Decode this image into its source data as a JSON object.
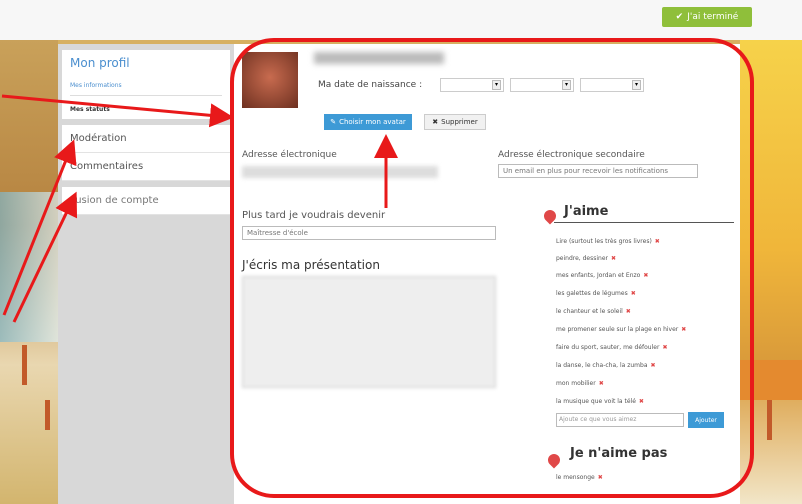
{
  "top_button": {
    "label": "J'ai terminé",
    "icon": "check-icon"
  },
  "sidebar": {
    "title": "Mon profil",
    "sub_link": "Mes informations",
    "sub_active": "Mes statuts",
    "items": [
      {
        "label": "Modération"
      },
      {
        "label": "Commentaires"
      },
      {
        "label": "Fusion de compte"
      }
    ]
  },
  "profile": {
    "dob_label": "Ma date de naissance :",
    "change_photo_label": "Choisir mon avatar",
    "delete_label": "Supprimer"
  },
  "form": {
    "email_label": "Adresse électronique",
    "secondary_email_label": "Adresse électronique secondaire",
    "secondary_email_placeholder": "Un email en plus pour recevoir les notifications",
    "career_label": "Plus tard je voudrais devenir",
    "career_value": "Maîtresse d'école",
    "presentation_title": "J'écris ma présentation"
  },
  "likes": {
    "title": "J'aime",
    "items": [
      "Lire (surtout les très gros livres)",
      "peindre, dessiner",
      "mes enfants, Jordan et Enzo",
      "les galettes de légumes",
      "le chanteur et le soleil",
      "me promener seule sur la plage en hiver",
      "faire du sport, sauter, me défouler",
      "la danse, le cha-cha, la zumba",
      "mon mobilier",
      "la musique que voit la télé"
    ],
    "add_placeholder": "Ajoute ce que vous aimez",
    "add_button": "Ajouter",
    "dislikes_title": "Je n'aime pas",
    "dislike_items": [
      "le mensonge"
    ]
  },
  "colors": {
    "accent": "#3d9ad6",
    "annotation": "#e8191a",
    "heart": "#e04848",
    "done": "#8fbf3a"
  }
}
